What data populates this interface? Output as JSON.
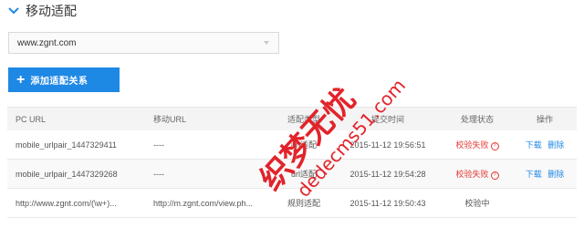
{
  "section": {
    "title": "移动适配",
    "icon": "chevron-down-icon"
  },
  "site_select": {
    "value": "www.zgnt.com"
  },
  "add_button": {
    "label": "添加适配关系",
    "icon": "plus-icon"
  },
  "table": {
    "headers": {
      "pc_url": "PC URL",
      "mobile_url": "移动URL",
      "type": "适配类型",
      "time": "提交时间",
      "status": "处理状态",
      "ops": "操作"
    },
    "rows": [
      {
        "pc_url": "mobile_urlpair_1447329411",
        "mobile_url": "----",
        "type": "url适配",
        "time": "2015-11-12 19:56:51",
        "status": "校验失败",
        "status_kind": "fail",
        "ops": [
          "下载",
          "删除"
        ]
      },
      {
        "pc_url": "mobile_urlpair_1447329268",
        "mobile_url": "----",
        "type": "url适配",
        "time": "2015-11-12 19:54:28",
        "status": "校验失败",
        "status_kind": "fail",
        "ops": [
          "下载",
          "删除"
        ]
      },
      {
        "pc_url": "http://www.zgnt.com/(\\w+)...",
        "mobile_url": "http://m.zgnt.com/view.ph...",
        "type": "规则适配",
        "time": "2015-11-12 19:50:43",
        "status": "校验中",
        "status_kind": "pending",
        "ops": []
      }
    ]
  },
  "watermark": {
    "text": "织梦无忧 dedecms51.com",
    "color": "#e2232a"
  },
  "colors": {
    "accent": "#1e88e5",
    "fail": "#e53935",
    "header_bg": "#f4f4f4"
  }
}
